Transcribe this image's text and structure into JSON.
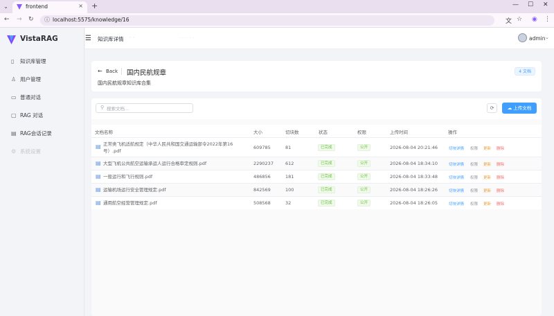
{
  "browser": {
    "tab_title": "frontend",
    "tab_close_icon": "×",
    "new_tab_icon": "+",
    "url": "localhost:5575/knowledge/16",
    "window_controls": [
      "—",
      "☐",
      "✕"
    ]
  },
  "sidebar": {
    "app_name": "VistaRAG",
    "items": [
      {
        "label": "知识库管理",
        "icon": "document-icon",
        "glyph": "▯"
      },
      {
        "label": "用户管理",
        "icon": "user-icon",
        "glyph": "♙"
      },
      {
        "label": "普通对话",
        "icon": "monitor-icon",
        "glyph": "▭"
      },
      {
        "label": "RAG 对话",
        "icon": "chat-icon",
        "glyph": "▢"
      },
      {
        "label": "RAG会话记录",
        "icon": "message-icon",
        "glyph": "▤"
      },
      {
        "label": "系统设置",
        "icon": "settings-icon",
        "glyph": "⚙"
      }
    ]
  },
  "header": {
    "title": "知识库详情",
    "user": "admin"
  },
  "kb": {
    "back_label": "Back",
    "title": "国内民航规章",
    "description": "国内民航规章知识库合集",
    "doc_count": "4 文档"
  },
  "toolbar": {
    "search_placeholder": "搜索文档...",
    "upload_label": "上传文档"
  },
  "table": {
    "columns": [
      "文档名称",
      "大小",
      "切块数",
      "状态",
      "权限",
      "上传时间",
      "操作"
    ],
    "rows": [
      {
        "name": "正常类飞机适航规定（中华人民共和国交通运输部令2022年第16号）.pdf",
        "size": "609785",
        "chunks": "81",
        "status": "已完成",
        "permission": "公开",
        "time": "2026-08-04 20:21:46"
      },
      {
        "name": "大型飞机公共航空运输承运人运行合格审定规则.pdf",
        "size": "2290237",
        "chunks": "612",
        "status": "已完成",
        "permission": "公开",
        "time": "2026-08-04 18:34:10"
      },
      {
        "name": "一般运行和飞行规则.pdf",
        "size": "486856",
        "chunks": "181",
        "status": "已完成",
        "permission": "公开",
        "time": "2026-08-04 18:33:48"
      },
      {
        "name": "运输机场运行安全管理规定.pdf",
        "size": "842569",
        "chunks": "100",
        "status": "已完成",
        "permission": "公开",
        "time": "2026-08-04 18:26:26"
      },
      {
        "name": "通用航空经营管理规定.pdf",
        "size": "508568",
        "chunks": "32",
        "status": "已完成",
        "permission": "公开",
        "time": "2026-08-04 18:26:05"
      }
    ],
    "actions": {
      "chunk": "切块详情",
      "perm": "权限",
      "update": "更新",
      "delete": "删除"
    }
  }
}
